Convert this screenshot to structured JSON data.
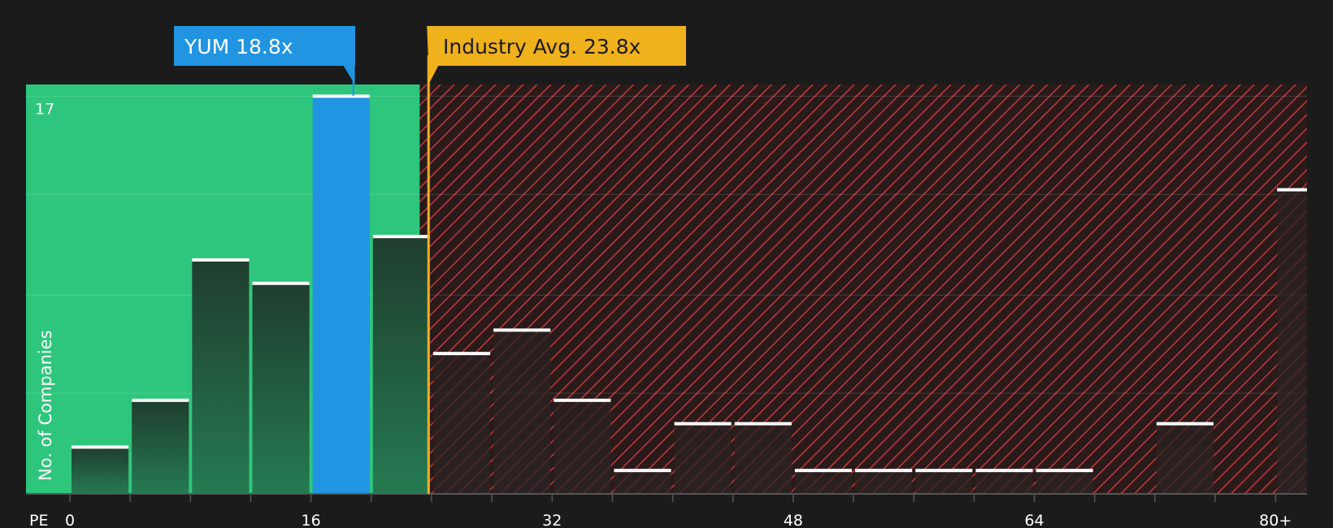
{
  "chart_data": {
    "type": "bar",
    "xlabel": "PE",
    "ylabel": "No. of Companies",
    "ylim": [
      0,
      17.5
    ],
    "ytick_labels": [
      {
        "value": 17,
        "label": "17"
      }
    ],
    "xtick_labels": [
      {
        "value": 0,
        "label": "0"
      },
      {
        "value": 16,
        "label": "16"
      },
      {
        "value": 32,
        "label": "32"
      },
      {
        "value": 48,
        "label": "48"
      },
      {
        "value": 64,
        "label": "64"
      },
      {
        "value": 80,
        "label": "80+"
      }
    ],
    "bins": [
      {
        "start": 0,
        "end": 4,
        "value": 2,
        "highlight": false
      },
      {
        "start": 4,
        "end": 8,
        "value": 4,
        "highlight": false
      },
      {
        "start": 8,
        "end": 12,
        "value": 10,
        "highlight": false
      },
      {
        "start": 12,
        "end": 16,
        "value": 9,
        "highlight": false
      },
      {
        "start": 16,
        "end": 20,
        "value": 17,
        "highlight": true
      },
      {
        "start": 20,
        "end": 24,
        "value": 11,
        "highlight": false
      },
      {
        "start": 24,
        "end": 28,
        "value": 6,
        "highlight": false
      },
      {
        "start": 28,
        "end": 32,
        "value": 7,
        "highlight": false
      },
      {
        "start": 32,
        "end": 36,
        "value": 4,
        "highlight": false
      },
      {
        "start": 36,
        "end": 40,
        "value": 1,
        "highlight": false
      },
      {
        "start": 40,
        "end": 44,
        "value": 3,
        "highlight": false
      },
      {
        "start": 44,
        "end": 48,
        "value": 3,
        "highlight": false
      },
      {
        "start": 48,
        "end": 52,
        "value": 1,
        "highlight": false
      },
      {
        "start": 52,
        "end": 56,
        "value": 1,
        "highlight": false
      },
      {
        "start": 56,
        "end": 60,
        "value": 1,
        "highlight": false
      },
      {
        "start": 60,
        "end": 64,
        "value": 1,
        "highlight": false
      },
      {
        "start": 64,
        "end": 68,
        "value": 1,
        "highlight": false
      },
      {
        "start": 68,
        "end": 72,
        "value": 0,
        "highlight": false
      },
      {
        "start": 72,
        "end": 76,
        "value": 3,
        "highlight": false
      },
      {
        "start": 76,
        "end": 80,
        "value": 0,
        "highlight": false
      },
      {
        "start": 80,
        "end": 82,
        "value": 13,
        "highlight": false
      }
    ],
    "company": {
      "label": "YUM 18.8x",
      "value": 18.8
    },
    "industry_avg": {
      "label": "Industry Avg. 23.8x",
      "value": 23.8
    },
    "fair_region_end": 23.0,
    "grid": true,
    "colors": {
      "background": "#1b1b1b",
      "undervalued_region": "#2ec67c",
      "overvalued_region": "#2a1a1a",
      "overvalued_hatch": "#c43a3a",
      "bar_dark": "#1f4a36",
      "bar_highlight": "#2194e2",
      "company_callout": "#2194e2",
      "industry_callout": "#efb11c",
      "industry_text": "#1b1b1b",
      "bar_cap": "#ffffff"
    }
  }
}
